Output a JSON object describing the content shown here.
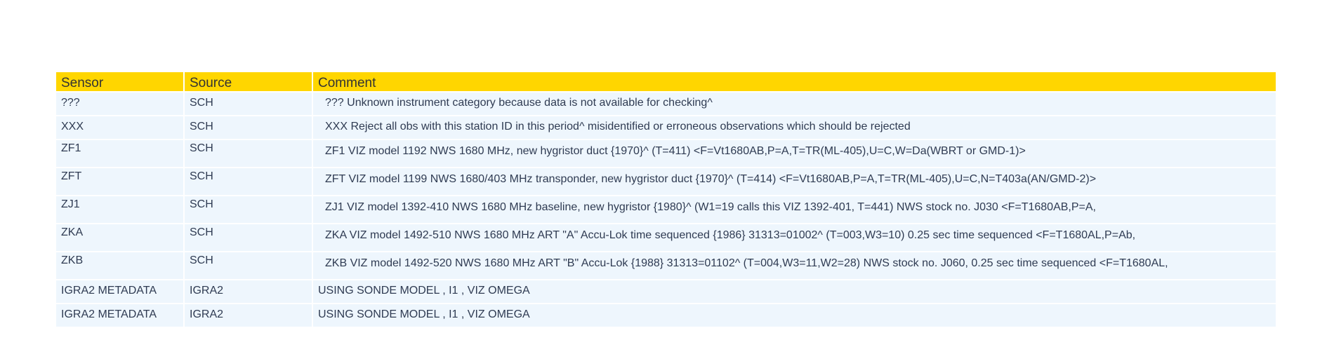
{
  "table": {
    "headers": {
      "sensor": "Sensor",
      "source": "Source",
      "comment": "Comment"
    },
    "rows": [
      {
        "sensor": "???",
        "source": "SCH",
        "comment": "??? Unknown instrument category because data is not available for checking^"
      },
      {
        "sensor": "XXX",
        "source": "SCH",
        "comment": "XXX Reject all obs with this station ID in this period^ misidentified or erroneous observations which should be rejected"
      },
      {
        "sensor": "ZF1",
        "source": "SCH",
        "comment": "ZF1 VIZ model 1192 NWS 1680 MHz, new hygristor duct {1970}^ (T=411) <F=Vt1680AB,P=A,T=TR(ML-405),U=C,W=Da(WBRT or GMD-1)>"
      },
      {
        "sensor": "ZFT",
        "source": "SCH",
        "comment": "ZFT VIZ model 1199 NWS 1680/403 MHz transponder, new hygristor duct {1970}^ (T=414) <F=Vt1680AB,P=A,T=TR(ML-405),U=C,N=T403a(AN/GMD-2)>"
      },
      {
        "sensor": "ZJ1",
        "source": "SCH",
        "comment": "ZJ1 VIZ model 1392-410 NWS 1680 MHz baseline, new hygristor {1980}^ (W1=19 calls this VIZ 1392-401, T=441) NWS stock no. J030 <F=T1680AB,P=A,"
      },
      {
        "sensor": "ZKA",
        "source": "SCH",
        "comment": "ZKA VIZ model 1492-510 NWS 1680 MHz ART \"A\" Accu-Lok time sequenced {1986} 31313=01002^ (T=003,W3=10) 0.25 sec time sequenced <F=T1680AL,P=Ab,"
      },
      {
        "sensor": "ZKB",
        "source": "SCH",
        "comment": "ZKB VIZ model 1492-520 NWS 1680 MHz ART \"B\" Accu-Lok {1988} 31313=01102^ (T=004,W3=11,W2=28) NWS stock no. J060, 0.25 sec time sequenced <F=T1680AL,"
      },
      {
        "sensor": "IGRA2 METADATA",
        "source": "IGRA2",
        "comment": "USING SONDE MODEL , I1 , VIZ OMEGA"
      },
      {
        "sensor": "IGRA2 METADATA",
        "source": "IGRA2",
        "comment": "USING SONDE MODEL , I1 , VIZ OMEGA"
      }
    ]
  }
}
